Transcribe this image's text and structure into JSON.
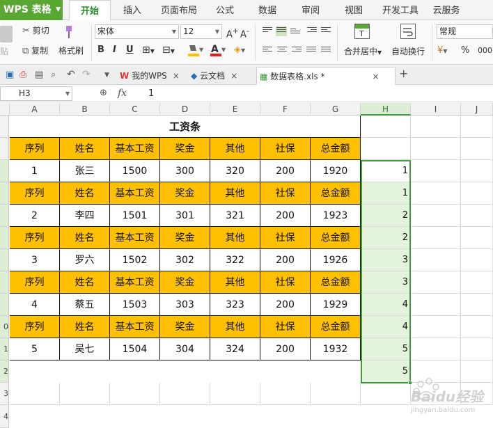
{
  "app": {
    "title": "WPS 表格"
  },
  "menu": {
    "tabs": [
      "开始",
      "插入",
      "页面布局",
      "公式",
      "数据",
      "审阅",
      "视图",
      "开发工具",
      "云服务"
    ]
  },
  "ribbon": {
    "paste": "贴",
    "cut": "剪切",
    "copy": "复制",
    "format_painter": "格式刷",
    "font_name": "宋体",
    "font_size": "12",
    "bold": "B",
    "italic": "I",
    "underline": "U",
    "merge_center": "合并居中",
    "wrap_text": "自动换行",
    "number_format": "常规",
    "percent": "%"
  },
  "doc_tabs": [
    {
      "label": "我的WPS"
    },
    {
      "label": "云文档"
    },
    {
      "label": "数据表格.xls *"
    }
  ],
  "formula_bar": {
    "cell_ref": "H3",
    "fx": "fx",
    "value": "1"
  },
  "grid": {
    "columns": [
      "A",
      "B",
      "C",
      "D",
      "E",
      "F",
      "G",
      "H",
      "I",
      "J"
    ],
    "rows": [
      "",
      "",
      "",
      "",
      "",
      "",
      "",
      "",
      "",
      "0",
      "1",
      "2",
      "3",
      "4"
    ],
    "title": "工资条",
    "header_row": [
      "序列",
      "姓名",
      "基本工资",
      "奖金",
      "其他",
      "社保",
      "总金额"
    ],
    "employees": [
      [
        "1",
        "张三",
        "1500",
        "300",
        "320",
        "200",
        "1920"
      ],
      [
        "2",
        "李四",
        "1501",
        "301",
        "321",
        "200",
        "1923"
      ],
      [
        "3",
        "罗六",
        "1502",
        "302",
        "322",
        "200",
        "1926"
      ],
      [
        "4",
        "蔡五",
        "1503",
        "303",
        "323",
        "200",
        "1929"
      ],
      [
        "5",
        "吴七",
        "1504",
        "304",
        "324",
        "200",
        "1932"
      ]
    ],
    "h_values": [
      "1",
      "1",
      "2",
      "2",
      "3",
      "3",
      "4",
      "4",
      "5",
      "5"
    ]
  },
  "watermark": {
    "brand": "Baidu经验",
    "url": "jingyan.baidu.com"
  },
  "colors": {
    "accent": "#5aa632",
    "header_fill": "#ffc000",
    "selection": "#3e9b3e"
  }
}
